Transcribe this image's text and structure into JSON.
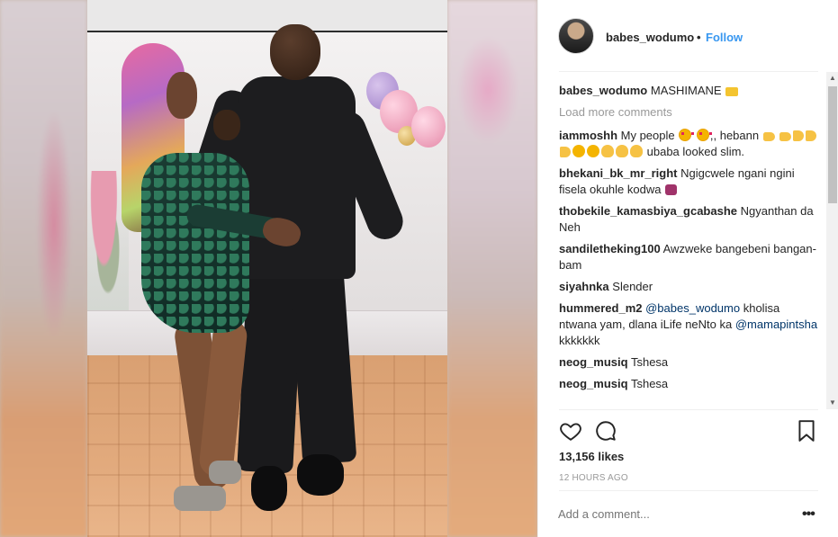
{
  "header": {
    "username": "babes_wodumo",
    "separator": "•",
    "follow_label": "Follow"
  },
  "caption": {
    "username": "babes_wodumo",
    "text": "MASHIMANE",
    "emoji": "crown-emoji"
  },
  "load_more_label": "Load more comments",
  "comments": [
    {
      "username": "iammoshh",
      "text_before": "My people",
      "text_middle": ",, hebann",
      "text_end": "ubaba looked slim."
    },
    {
      "username": "bhekani_bk_mr_right",
      "text": "Ngigcwele ngani ngini fisela okuhle kodwa"
    },
    {
      "username": "thobekile_kamasbiya_gcabashe",
      "text": "Ngyanthan da Neh"
    },
    {
      "username": "sandiletheking100",
      "text": "Awzweke bangebeni bangan-bam"
    },
    {
      "username": "siyahnka",
      "text": "Slender"
    },
    {
      "username": "hummered_m2",
      "mention1": "@babes_wodumo",
      "text": "kholisa ntwana yam, dlana iLife neNto ka",
      "mention2": "@mamapintsha",
      "text_end": "kkkkkkk"
    },
    {
      "username": "neog_musiq",
      "text": "Tshesa"
    },
    {
      "username": "neog_musiq",
      "text": "Tshesa"
    }
  ],
  "actions": {
    "like_icon": "heart-outline-icon",
    "comment_icon": "speech-bubble-icon",
    "save_icon": "bookmark-icon"
  },
  "likes": "13,156 likes",
  "time": "12 HOURS AGO",
  "comment_input": {
    "placeholder": "Add a comment..."
  },
  "more_options": "•••",
  "colors": {
    "accent": "#3897f0",
    "mention": "#003569",
    "muted": "#999999",
    "text": "#262626"
  }
}
